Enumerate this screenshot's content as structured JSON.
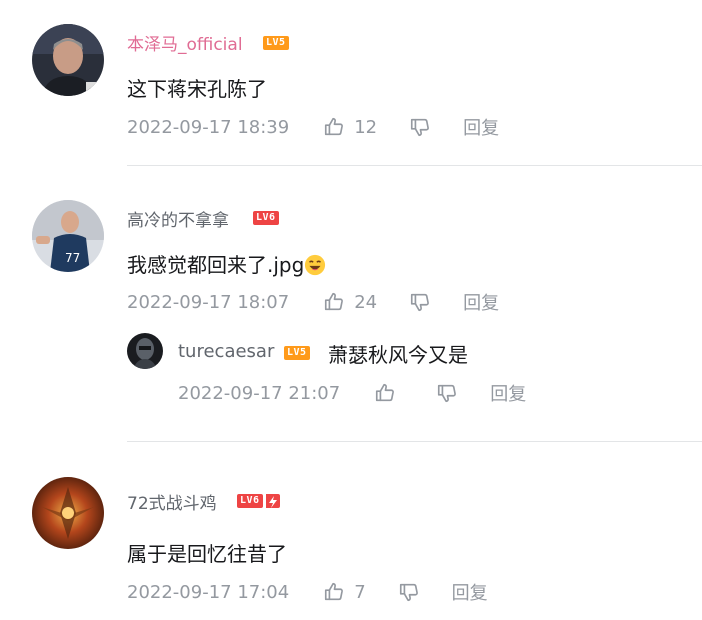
{
  "comments": [
    {
      "username": "本泽马_official",
      "level": "LV5",
      "text": "这下蒋宋孔陈了",
      "time": "2022-09-17 18:39",
      "likes": "12",
      "reply_label": "回复"
    },
    {
      "username": "高冷的不拿拿",
      "level": "LV6",
      "text": "我感觉都回来了.jpg",
      "time": "2022-09-17 18:07",
      "likes": "24",
      "reply_label": "回复",
      "sub_reply": {
        "username": "turecaesar",
        "level": "LV5",
        "text": "萧瑟秋风今又是",
        "time": "2022-09-17 21:07",
        "reply_label": "回复"
      }
    },
    {
      "username": "72式战斗鸡",
      "level": "LV6",
      "text": "属于是回忆往昔了",
      "time": "2022-09-17 17:04",
      "likes": "7",
      "reply_label": "回复"
    }
  ]
}
